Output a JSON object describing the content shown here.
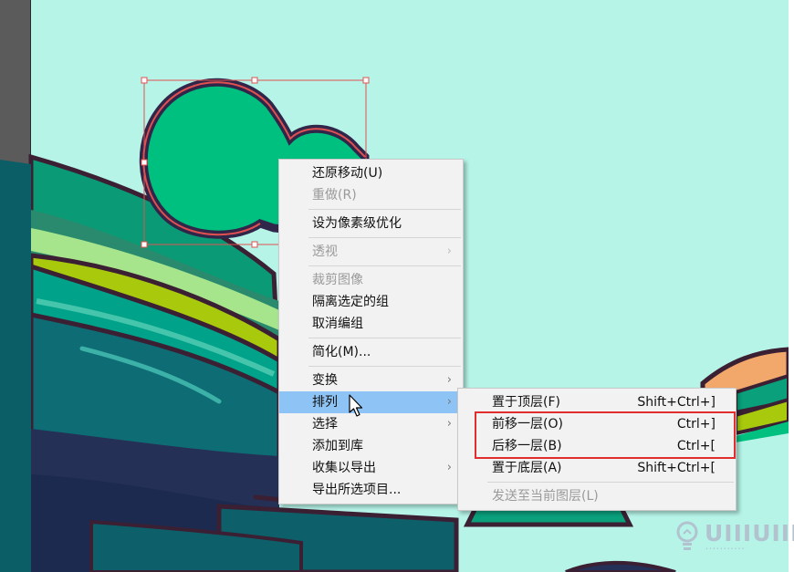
{
  "context_menu": {
    "items": [
      {
        "label": "还原移动(U)",
        "enabled": true
      },
      {
        "label": "重做(R)",
        "enabled": false
      },
      {
        "label": "设为像素级优化",
        "enabled": true
      },
      {
        "label": "透视",
        "enabled": false,
        "submenu": true
      },
      {
        "label": "裁剪图像",
        "enabled": false
      },
      {
        "label": "隔离选定的组",
        "enabled": true
      },
      {
        "label": "取消编组",
        "enabled": true
      },
      {
        "label": "简化(M)...",
        "enabled": true
      },
      {
        "label": "变换",
        "enabled": true,
        "submenu": true
      },
      {
        "label": "排列",
        "enabled": true,
        "submenu": true,
        "highlighted": true
      },
      {
        "label": "选择",
        "enabled": true,
        "submenu": true
      },
      {
        "label": "添加到库",
        "enabled": true
      },
      {
        "label": "收集以导出",
        "enabled": true,
        "submenu": true
      },
      {
        "label": "导出所选项目...",
        "enabled": true
      }
    ]
  },
  "arrange_submenu": {
    "items": [
      {
        "label": "置于顶层(F)",
        "shortcut": "Shift+Ctrl+]",
        "enabled": true
      },
      {
        "label": "前移一层(O)",
        "shortcut": "Ctrl+]",
        "enabled": true
      },
      {
        "label": "后移一层(B)",
        "shortcut": "Ctrl+[",
        "enabled": true
      },
      {
        "label": "置于底层(A)",
        "shortcut": "Shift+Ctrl+[",
        "enabled": true
      },
      {
        "label": "发送至当前图层(L)",
        "enabled": false
      }
    ]
  },
  "icons": {
    "submenu_arrow": "›",
    "cursor": "arrow-pointer-icon",
    "logo": "lightbulb-icon"
  },
  "watermark": {
    "text": "UIIIUIII",
    "subtext": "•••••••••••"
  },
  "colors": {
    "canvas_bg": "#b6f4e8",
    "highlight": "#8ec4f5",
    "annotation": "#e02d2d",
    "selection": "#e05050",
    "shape_fill": "#00c080"
  }
}
